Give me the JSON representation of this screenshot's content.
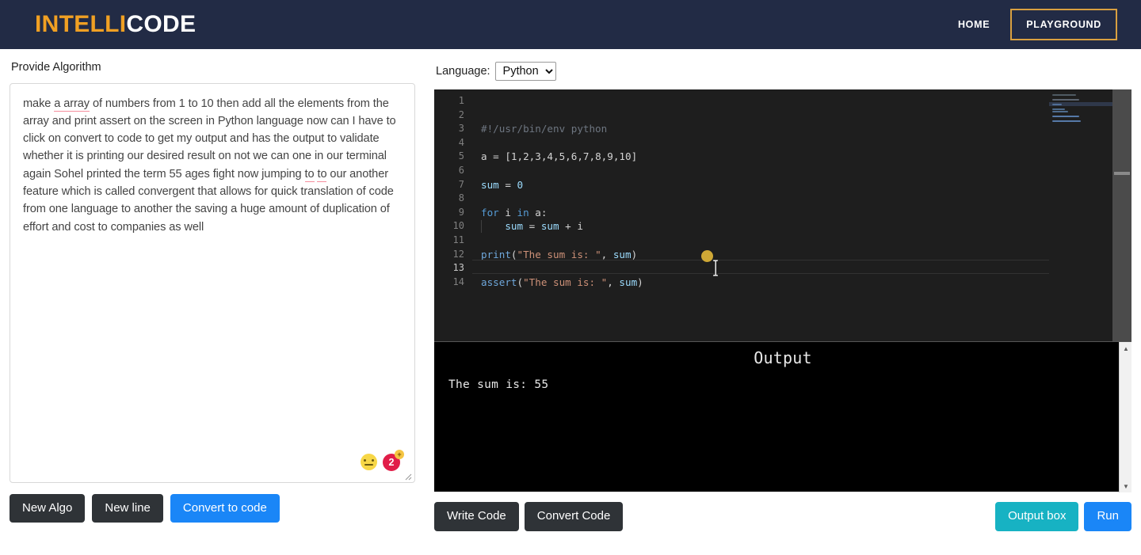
{
  "header": {
    "brand_intelli": "INTELLI",
    "brand_code": "CODE",
    "nav": {
      "home": "HOME",
      "playground": "PLAYGROUND"
    },
    "colors": {
      "bar_bg": "#222b45",
      "brand_accent": "#f0a023",
      "playground_border": "#d9a040"
    }
  },
  "left": {
    "panel_label": "Provide Algorithm",
    "algorithm_text_parts": {
      "p1": "make ",
      "err1": "a array",
      "p2": " of numbers from 1 to 10 then add all the elements from the array and print assert on the screen in Python language now can I have to click on convert to code to get my output and has the output to validate whether it is printing our desired result on not we can one in our terminal again Sohel printed the term 55 ages fight now jumping ",
      "err2": "to",
      "p3": " ",
      "err3": "to",
      "p4": " our another feature which is called convergent that allows for quick translation of code from one language to another the saving a huge amount of duplication of effort and cost to companies as well"
    },
    "algorithm_full_text": "make a array of numbers from 1 to 10 then add all the elements from the array and print assert on the screen in Python language now can I have to click on convert to code to get my output and has the output to validate whether it is printing our desired result on not we can one in our terminal again Sohel printed the term 55 ages fight now jumping to to our another feature which is called convergent that allows for quick translation of code from one language to another the saving a huge amount of duplication of effort and cost to companies as well",
    "grammar_widget": {
      "alert_count": "2",
      "alert_plus": "+",
      "face_icon": "neutral-face-icon"
    },
    "buttons": {
      "new_algo": "New Algo",
      "new_line": "New line",
      "convert_to_code": "Convert to code"
    }
  },
  "right": {
    "language_label": "Language:",
    "language_selected": "Python",
    "language_options": [
      "Python"
    ],
    "editor": {
      "lines": [
        {
          "n": "1",
          "tokens": []
        },
        {
          "n": "2",
          "tokens": []
        },
        {
          "n": "3",
          "tokens": [
            {
              "t": "#!/usr/bin/env python",
              "c": "tk-comment-gray"
            }
          ]
        },
        {
          "n": "4",
          "tokens": []
        },
        {
          "n": "5",
          "tokens": [
            {
              "t": "a",
              "c": "tk-op"
            },
            {
              "t": " = ",
              "c": "tk-op"
            },
            {
              "t": "[1,2,3,4,5,6,7,8,9,10]",
              "c": "tk-op"
            }
          ]
        },
        {
          "n": "6",
          "tokens": []
        },
        {
          "n": "7",
          "tokens": [
            {
              "t": "sum",
              "c": "tk-var"
            },
            {
              "t": " = ",
              "c": "tk-op"
            },
            {
              "t": "0",
              "c": "tk-var"
            }
          ]
        },
        {
          "n": "8",
          "tokens": []
        },
        {
          "n": "9",
          "tokens": [
            {
              "t": "for",
              "c": "tk-kw"
            },
            {
              "t": " i ",
              "c": "tk-op"
            },
            {
              "t": "in",
              "c": "tk-kw"
            },
            {
              "t": " a:",
              "c": "tk-op"
            }
          ]
        },
        {
          "n": "10",
          "tokens": [
            {
              "t": "    ",
              "c": "tk-op"
            },
            {
              "t": "sum",
              "c": "tk-var"
            },
            {
              "t": " = ",
              "c": "tk-op"
            },
            {
              "t": "sum",
              "c": "tk-var"
            },
            {
              "t": " + i",
              "c": "tk-op"
            }
          ]
        },
        {
          "n": "11",
          "tokens": []
        },
        {
          "n": "12",
          "tokens": [
            {
              "t": "print",
              "c": "tk-fn"
            },
            {
              "t": "(",
              "c": "tk-punc"
            },
            {
              "t": "\"The sum is: \"",
              "c": "tk-str"
            },
            {
              "t": ", ",
              "c": "tk-punc"
            },
            {
              "t": "sum",
              "c": "tk-var"
            },
            {
              "t": ")",
              "c": "tk-punc"
            }
          ]
        },
        {
          "n": "13",
          "tokens": []
        },
        {
          "n": "14",
          "tokens": [
            {
              "t": "assert",
              "c": "tk-fn"
            },
            {
              "t": "(",
              "c": "tk-punc"
            },
            {
              "t": "\"The sum is: \"",
              "c": "tk-str"
            },
            {
              "t": ", ",
              "c": "tk-punc"
            },
            {
              "t": "sum",
              "c": "tk-var"
            },
            {
              "t": ")",
              "c": "tk-punc"
            }
          ]
        }
      ],
      "active_line": "13",
      "source_code": "#!/usr/bin/env python\n\na = [1,2,3,4,5,6,7,8,9,10]\n\nsum = 0\n\nfor i in a:\n    sum = sum + i\n\nprint(\"The sum is: \", sum)\n\nassert(\"The sum is: \", sum)"
    },
    "output": {
      "title": "Output",
      "text": "The sum is: 55"
    },
    "buttons": {
      "write_code": "Write Code",
      "convert_code": "Convert Code",
      "output_box": "Output box",
      "run": "Run"
    }
  }
}
